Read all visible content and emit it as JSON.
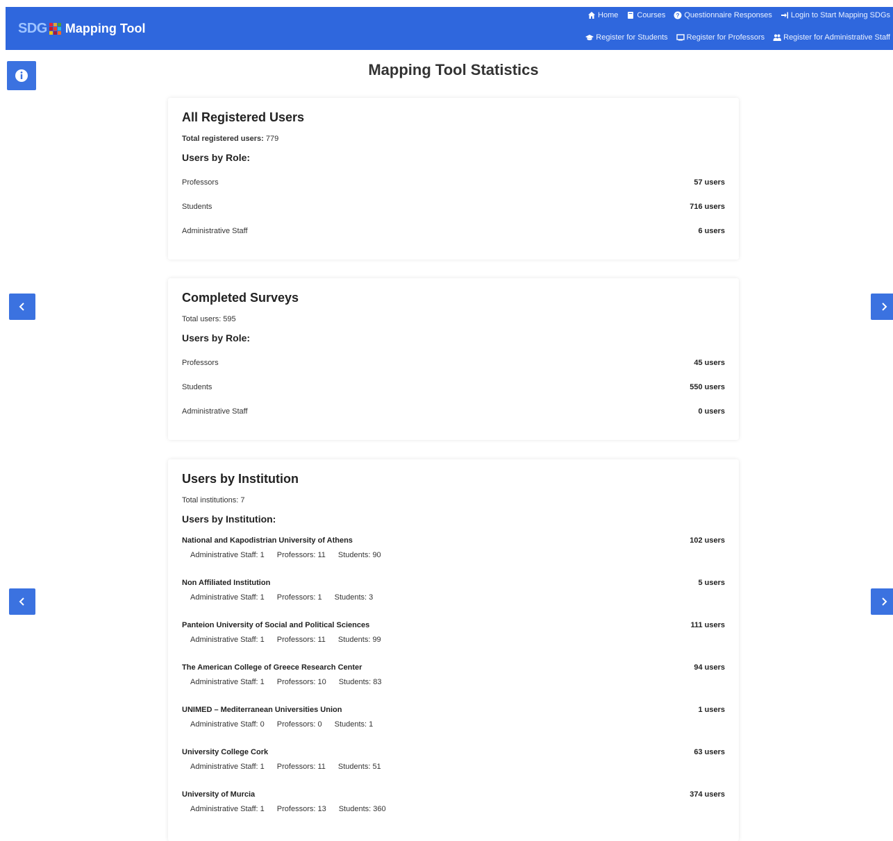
{
  "header": {
    "brand_logo": "SDG",
    "brand_title": "Mapping Tool",
    "nav_row1": [
      {
        "icon": "home-icon",
        "label": "Home"
      },
      {
        "icon": "book-icon",
        "label": "Courses"
      },
      {
        "icon": "question-circle-icon",
        "label": "Questionnaire Responses"
      },
      {
        "icon": "login-icon",
        "label": "Login to Start Mapping SDGs"
      }
    ],
    "nav_row2": [
      {
        "icon": "graduation-cap-icon",
        "label": "Register for Students"
      },
      {
        "icon": "chalkboard-icon",
        "label": "Register for Professors"
      },
      {
        "icon": "users-icon",
        "label": "Register for Administrative Staff"
      }
    ]
  },
  "page_title": "Mapping Tool Statistics",
  "registered": {
    "title": "All Registered Users",
    "total_label": "Total registered users:",
    "total_value": "779",
    "by_role_title": "Users by Role:",
    "roles": [
      {
        "name": "Professors",
        "count": "57 users"
      },
      {
        "name": "Students",
        "count": "716 users"
      },
      {
        "name": "Administrative Staff",
        "count": "6 users"
      }
    ]
  },
  "surveys": {
    "title": "Completed Surveys",
    "total_text": "Total users: 595",
    "by_role_title": "Users by Role:",
    "roles": [
      {
        "name": "Professors",
        "count": "45 users"
      },
      {
        "name": "Students",
        "count": "550 users"
      },
      {
        "name": "Administrative Staff",
        "count": "0 users"
      }
    ]
  },
  "institutions": {
    "title": "Users by Institution",
    "total_text": "Total institutions: 7",
    "list_title": "Users by Institution:",
    "items": [
      {
        "name": "National and Kapodistrian University of Athens",
        "count": "102 users",
        "admin": "Administrative Staff: 1",
        "prof": "Professors: 11",
        "stud": "Students: 90"
      },
      {
        "name": "Non Affiliated Institution",
        "count": "5 users",
        "admin": "Administrative Staff: 1",
        "prof": "Professors: 1",
        "stud": "Students: 3"
      },
      {
        "name": "Panteion University of Social and Political Sciences",
        "count": "111 users",
        "admin": "Administrative Staff: 1",
        "prof": "Professors: 11",
        "stud": "Students: 99"
      },
      {
        "name": "The American College of Greece Research Center",
        "count": "94 users",
        "admin": "Administrative Staff: 1",
        "prof": "Professors: 10",
        "stud": "Students: 83"
      },
      {
        "name": "UNIMED – Mediterranean Universities Union",
        "count": "1 users",
        "admin": "Administrative Staff: 0",
        "prof": "Professors: 0",
        "stud": "Students: 1"
      },
      {
        "name": "University College Cork",
        "count": "63 users",
        "admin": "Administrative Staff: 1",
        "prof": "Professors: 11",
        "stud": "Students: 51"
      },
      {
        "name": "University of Murcia",
        "count": "374 users",
        "admin": "Administrative Staff: 1",
        "prof": "Professors: 13",
        "stud": "Students: 360"
      }
    ]
  },
  "colors": {
    "primary": "#2f67dd",
    "button": "#3b72e0"
  }
}
